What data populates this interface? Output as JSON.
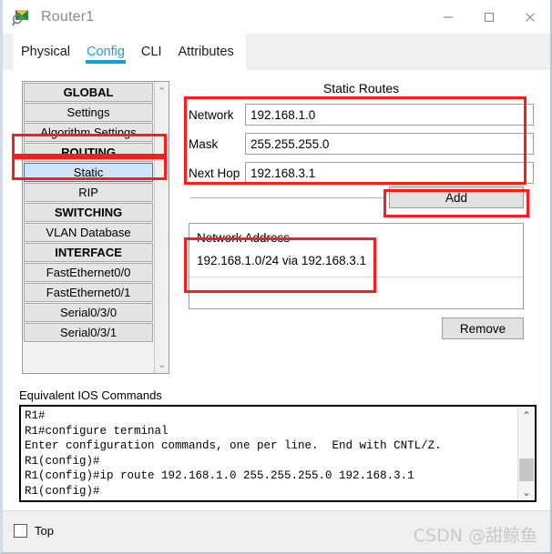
{
  "window": {
    "title": "Router1",
    "icon": "router-icon",
    "controls": {
      "minimize": "minimize-icon",
      "maximize": "maximize-icon",
      "close": "close-icon"
    }
  },
  "tabs": [
    {
      "label": "Physical",
      "active": false
    },
    {
      "label": "Config",
      "active": true
    },
    {
      "label": "CLI",
      "active": false
    },
    {
      "label": "Attributes",
      "active": false
    }
  ],
  "sidebar": {
    "items": [
      {
        "label": "GLOBAL",
        "type": "header",
        "selected": false
      },
      {
        "label": "Settings",
        "type": "item",
        "selected": false
      },
      {
        "label": "Algorithm Settings",
        "type": "item",
        "selected": false
      },
      {
        "label": "ROUTING",
        "type": "header",
        "selected": false
      },
      {
        "label": "Static",
        "type": "item",
        "selected": true
      },
      {
        "label": "RIP",
        "type": "item",
        "selected": false
      },
      {
        "label": "SWITCHING",
        "type": "header",
        "selected": false
      },
      {
        "label": "VLAN Database",
        "type": "item",
        "selected": false
      },
      {
        "label": "INTERFACE",
        "type": "header",
        "selected": false
      },
      {
        "label": "FastEthernet0/0",
        "type": "item",
        "selected": false
      },
      {
        "label": "FastEthernet0/1",
        "type": "item",
        "selected": false
      },
      {
        "label": "Serial0/3/0",
        "type": "item",
        "selected": false
      },
      {
        "label": "Serial0/3/1",
        "type": "item",
        "selected": false
      }
    ],
    "scroll_up": "⌃",
    "scroll_down": "⌄"
  },
  "panel": {
    "title": "Static Routes",
    "fields": [
      {
        "label": "Network",
        "value": "192.168.1.0"
      },
      {
        "label": "Mask",
        "value": "255.255.255.0"
      },
      {
        "label": "Next Hop",
        "value": "192.168.3.1"
      }
    ],
    "add_label": "Add",
    "remove_label": "Remove",
    "route_list_header": "Network Address",
    "routes": [
      "192.168.1.0/24 via 192.168.3.1"
    ]
  },
  "console": {
    "label": "Equivalent IOS Commands",
    "text": "R1#\nR1#configure terminal\nEnter configuration commands, one per line.  End with CNTL/Z.\nR1(config)#\nR1(config)#ip route 192.168.1.0 255.255.255.0 192.168.3.1\nR1(config)#",
    "scroll_up": "⌃",
    "scroll_down": "⌄"
  },
  "bottom": {
    "top_checkbox_label": "Top",
    "top_checkbox_checked": false,
    "watermark": "CSDN @甜鲸鱼"
  },
  "colors": {
    "accent": "#1a9fd4",
    "highlight": "#fc1c1c",
    "selection": "#cfe4f7",
    "button_face": "#e1e1e1"
  }
}
